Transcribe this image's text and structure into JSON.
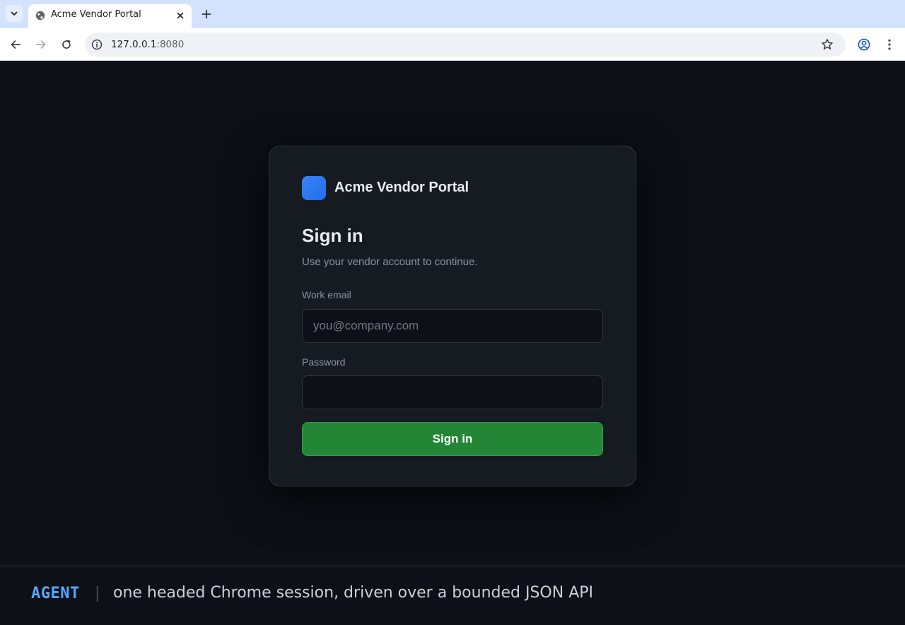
{
  "browser": {
    "tab_title": "Acme Vendor Portal",
    "url_host": "127.0.0.1",
    "url_port": ":8080",
    "icons": {
      "tab_menu": "chevron-down-icon",
      "favicon": "globe-icon",
      "tab_close": "close-icon",
      "new_tab": "plus-icon",
      "back": "arrow-left-icon",
      "forward": "arrow-right-icon",
      "reload": "reload-icon",
      "site_info": "info-icon",
      "bookmark": "star-icon",
      "profile": "profile-icon",
      "menu": "kebab-menu-icon"
    }
  },
  "login": {
    "brand_name": "Acme Vendor Portal",
    "heading": "Sign in",
    "subtitle": "Use your vendor account to continue.",
    "email_label": "Work email",
    "email_placeholder": "you@company.com",
    "email_value": "",
    "password_label": "Password",
    "password_value": "",
    "submit_label": "Sign in"
  },
  "caption": {
    "tag": "AGENT",
    "separator": "|",
    "text": "one headed Chrome session, driven over a bounded JSON API"
  },
  "colors": {
    "page_bg": "#0d1117",
    "card_bg": "#161b22",
    "accent_blue": "#2f81f7",
    "submit_green": "#238636",
    "caption_tag": "#58a6ff"
  }
}
